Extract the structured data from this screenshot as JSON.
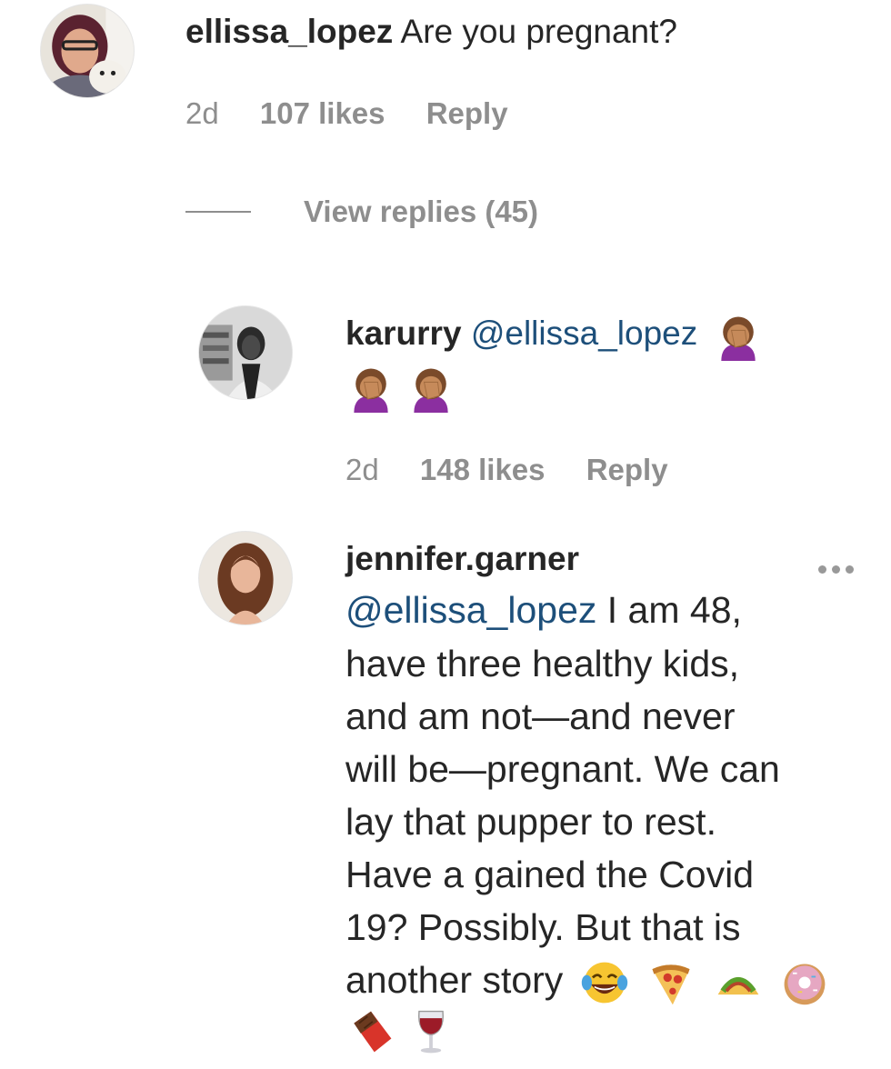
{
  "comments": [
    {
      "username": "ellissa_lopez",
      "text": "Are you pregnant?",
      "time": "2d",
      "likes": "107 likes",
      "reply": "Reply"
    }
  ],
  "view_replies": "View replies (45)",
  "replies": [
    {
      "username": "karurry",
      "mention": "@ellissa_lopez",
      "emojis": [
        "facepalm-woman-emoji",
        "facepalm-woman-emoji",
        "facepalm-woman-emoji"
      ],
      "time": "2d",
      "likes": "148 likes",
      "reply": "Reply"
    },
    {
      "username": "jennifer.garner",
      "mention": "@ellissa_lopez",
      "lines": [
        " I am 48,",
        "have three healthy kids,",
        "and am not—and never",
        "will be—pregnant. We can",
        "lay that pupper to rest.",
        "Have a gained the Covid",
        "19? Possibly. But that is",
        "another story"
      ],
      "emojis": [
        "laughing-tears-emoji",
        "pizza-emoji",
        "taco-emoji",
        "donut-emoji",
        "chocolate-bar-emoji",
        "wine-glass-emoji"
      ]
    }
  ],
  "colors": {
    "text": "#262626",
    "meta": "#8e8e8e",
    "mention": "#1d4f7a"
  }
}
